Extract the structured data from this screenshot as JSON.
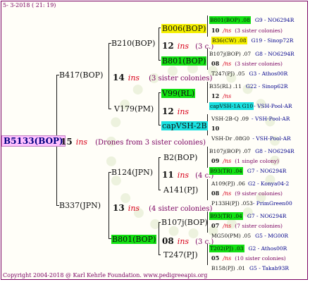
{
  "header": {
    "date": "5-  3-2018 ( 21: 19)"
  },
  "footer": {
    "copyright": "Copyright 2004-2018 @ Karl Kehrle Foundation.   www.pedigreeapis.org"
  },
  "root": {
    "name": "B5133(BOP)",
    "ins_num": "15",
    "ins": "ins",
    "note": "(Drones from 3 sister colonies)"
  },
  "gen1": [
    {
      "name": "B417(BOP)",
      "ins_num": "14",
      "ins": "ins",
      "note": "(3 sister colonies)"
    },
    {
      "name": "B337(JPN)",
      "ins_num": "13",
      "ins": "ins",
      "note": "(4 sister colonies)"
    }
  ],
  "gen2": [
    {
      "name": "B210(BOP)",
      "ins_num": "12",
      "ins": "ins",
      "note": "(3 c.)"
    },
    {
      "name": "V179(PM)",
      "ins_num": "12",
      "ins": "ins",
      "note": ""
    },
    {
      "name": "B124(JPN)",
      "ins_num": "11",
      "ins": "ins",
      "note": "(4 c.)"
    },
    {
      "name": "B801(BOP)",
      "ins_num": "08",
      "ins": "ins",
      "note": "(3 c.)"
    }
  ],
  "gen3": [
    {
      "name": "B006(BOP)"
    },
    {
      "name": "B801(BOP)"
    },
    {
      "name": "V99(RL)"
    },
    {
      "name": "capVSH-2B"
    },
    {
      "name": "B2(BOP)"
    },
    {
      "name": "A141(PJ)"
    },
    {
      "name": "B107j(BOP)"
    },
    {
      "name": "T247(PJ)"
    }
  ],
  "gen4": [
    {
      "l1a": "B801(BOP) .08",
      "l1b": "G9 - NO6294R",
      "l2n": "10",
      "l2i": "/ns",
      "l2s": "(3 sister colonies)",
      "l3a": "B36(CW) .08",
      "l3b": "G19 - Sinop72R"
    },
    {
      "l1a": "B107j(BOP) .07",
      "l1b": "G8 - NO6294R",
      "l2n": "08",
      "l2i": "/ns",
      "l2s": "(3 sister colonies)",
      "l3a": "T247(PJ) .05",
      "l3b": "G3 - Athos00R"
    },
    {
      "l1a": "B35(RL) .11",
      "l1b": "G22 - Sinop62R",
      "l2n": "12",
      "l2i": "/ns",
      "l2s": "",
      "l3a": "capVSH-1A G10",
      "l3b": "- VSH-Pool-AR"
    },
    {
      "l1a": "VSH-2B-Q .09",
      "l1b": "- VSH-Pool-AR",
      "l2n": "10",
      "l2i": "",
      "l2s": "",
      "l3a": "VSH-Dr .08G0",
      "l3b": "- VSH-Pool-AR"
    },
    {
      "l1a": "B107j(BOP) .07",
      "l1b": "G8 - NO6294R",
      "l2n": "09",
      "l2i": "/ns",
      "l2s": "(1 single colony)",
      "l3a": "B93(TR) .04",
      "l3b": "G7 - NO6294R"
    },
    {
      "l1a": "A109(PJ) .06",
      "l1b": "G2 - Konya04-2",
      "l2n": "08",
      "l2i": "/ns",
      "l2s": "(9 sister colonies)",
      "l3a": "P133H(PJ) .053",
      "l3b": "- PrimGreen00"
    },
    {
      "l1a": "B93(TR) .04",
      "l1b": "G7 - NO6294R",
      "l2n": "07",
      "l2i": "/ns",
      "l2s": "(7 sister colonies)",
      "l3a": "MG50(PM) .05",
      "l3b": "G5 - MG00R"
    },
    {
      "l1a": "T202(PJ) .03",
      "l1b": "G2 - Athos00R",
      "l2n": "05",
      "l2i": "/ns",
      "l2s": "(10 sister colonies)",
      "l3a": "B158(PJ) .01",
      "l3b": "G5 - Takab93R"
    }
  ]
}
